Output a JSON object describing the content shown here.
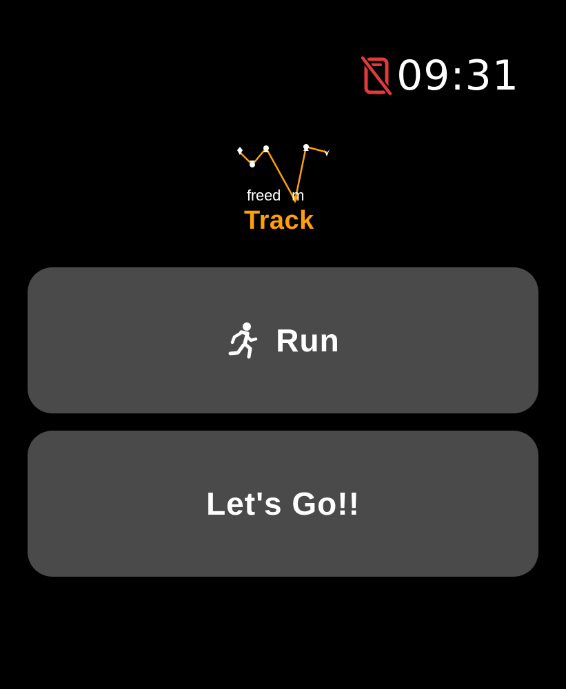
{
  "status_bar": {
    "time": "09:31",
    "connection_icon": "iphone-disconnected-icon",
    "connection_color": "#e5393b"
  },
  "logo": {
    "word_left": "freed",
    "word_right": "m",
    "title": "Track",
    "accent_color": "#ff9f0a"
  },
  "buttons": {
    "run": {
      "label": "Run",
      "icon": "running-figure-icon"
    },
    "go": {
      "label": "Let's Go!!"
    }
  },
  "colors": {
    "background": "#000000",
    "button_fill": "#4a4a4a",
    "text": "#ffffff"
  }
}
